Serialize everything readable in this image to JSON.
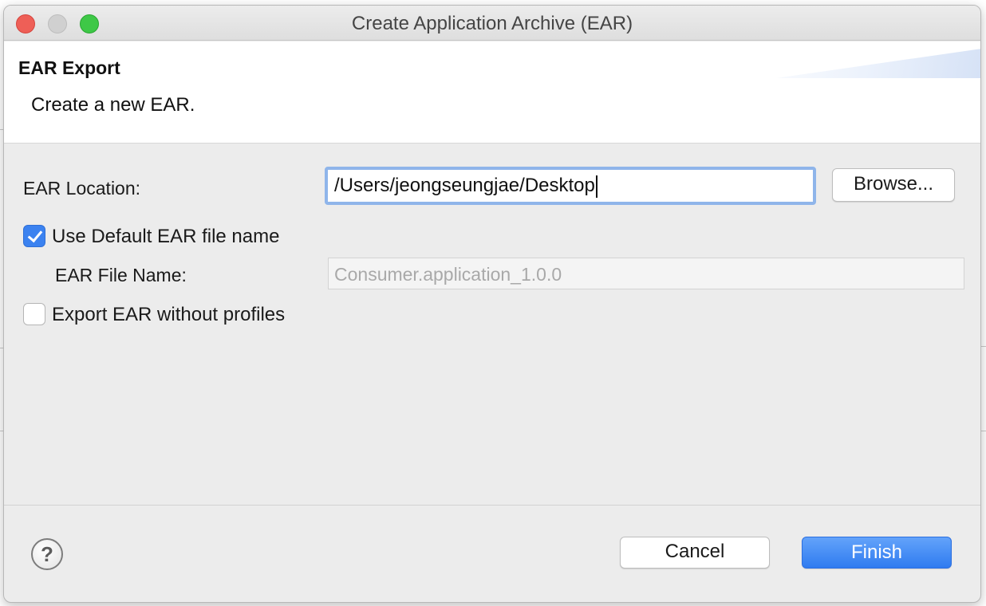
{
  "window": {
    "title": "Create Application Archive (EAR)"
  },
  "banner": {
    "title": "EAR Export",
    "description": "Create a new EAR."
  },
  "form": {
    "ear_location_label": "EAR Location:",
    "ear_location_value": "/Users/jeongseungjae/Desktop",
    "browse_label": "Browse...",
    "use_default_label": "Use Default EAR file name",
    "use_default_checked": true,
    "ear_file_name_label": "EAR File Name:",
    "ear_file_name_value": "Consumer.application_1.0.0",
    "export_without_profiles_label": "Export EAR without profiles",
    "export_without_profiles_checked": false
  },
  "footer": {
    "help_icon": "help-icon",
    "cancel_label": "Cancel",
    "finish_label": "Finish"
  },
  "colors": {
    "accent": "#3b82f0",
    "close": "#ee5f57",
    "zoom": "#3ec847"
  }
}
